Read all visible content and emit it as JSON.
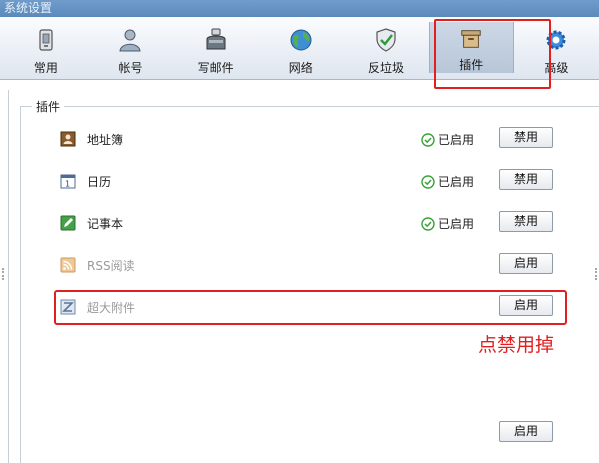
{
  "window": {
    "title": "系统设置"
  },
  "toolbar": {
    "tabs": [
      {
        "label": "常用",
        "icon": "phone-icon"
      },
      {
        "label": "帐号",
        "icon": "user-icon"
      },
      {
        "label": "写邮件",
        "icon": "mailbox-icon"
      },
      {
        "label": "网络",
        "icon": "globe-icon"
      },
      {
        "label": "反垃圾",
        "icon": "shield-icon"
      },
      {
        "label": "插件",
        "icon": "box-icon",
        "active": true
      },
      {
        "label": "高级",
        "icon": "gear-icon"
      }
    ]
  },
  "plugins": {
    "group_title": "插件",
    "items": [
      {
        "name": "地址簿",
        "icon": "addressbook-icon",
        "status": "已启用",
        "button": "禁用",
        "enabled": true
      },
      {
        "name": "日历",
        "icon": "calendar-icon",
        "status": "已启用",
        "button": "禁用",
        "enabled": true
      },
      {
        "name": "记事本",
        "icon": "notepad-icon",
        "status": "已启用",
        "button": "禁用",
        "enabled": true
      },
      {
        "name": "RSS阅读",
        "icon": "rss-icon",
        "status": "",
        "button": "启用",
        "enabled": false
      },
      {
        "name": "超大附件",
        "icon": "attachment-icon",
        "status": "",
        "button": "启用",
        "enabled": false
      }
    ],
    "bottom_button": "启用"
  },
  "annotation": {
    "text": "点禁用掉"
  },
  "colors": {
    "highlight": "#e02020",
    "toolbar_active": "#b7c6d8",
    "enabled_check": "#3aa23a"
  }
}
